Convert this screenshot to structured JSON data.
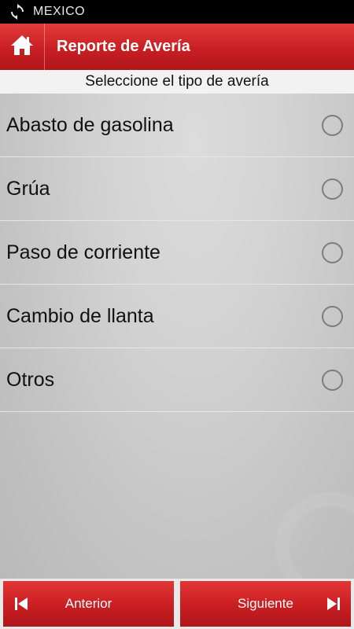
{
  "status_bar": {
    "carrier": "MEXICO",
    "icon": "sync-icon"
  },
  "app_bar": {
    "title": "Reporte de Avería",
    "home_icon": "home-icon"
  },
  "subheader": {
    "text": "Seleccione el tipo de avería"
  },
  "options": [
    {
      "label": "Abasto de gasolina",
      "selected": false
    },
    {
      "label": "Grúa",
      "selected": false
    },
    {
      "label": "Paso de corriente",
      "selected": false
    },
    {
      "label": "Cambio de llanta",
      "selected": false
    },
    {
      "label": "Otros",
      "selected": false
    }
  ],
  "footer": {
    "prev_label": "Anterior",
    "next_label": "Siguiente",
    "prev_icon": "skip-previous-icon",
    "next_icon": "skip-next-icon"
  },
  "colors": {
    "accent": "#c91f23",
    "content_bg": "#d0d0d0",
    "subheader_bg": "#f2f2f2"
  }
}
